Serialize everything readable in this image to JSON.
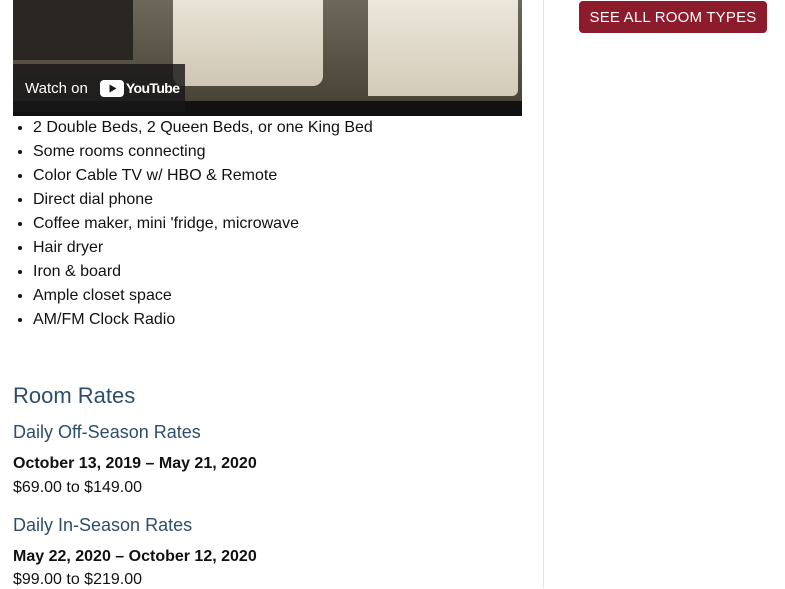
{
  "video": {
    "watch_label": "Watch on",
    "brand": "YouTube"
  },
  "sidebar": {
    "see_all_label": "SEE ALL ROOM TYPES"
  },
  "amenities": [
    "2 Double Beds, 2 Queen Beds, or one King Bed",
    "Some rooms connecting",
    "Color Cable TV w/ HBO & Remote",
    "Direct dial phone",
    "Coffee maker, mini 'fridge, microwave",
    "Hair dryer",
    "Iron & board",
    "Ample closet space",
    "AM/FM Clock Radio"
  ],
  "rates": {
    "heading": "Room Rates",
    "off_season": {
      "title": "Daily Off-Season Rates",
      "dates": "October 13, 2019 – May 21, 2020",
      "price": "$69.00 to $149.00"
    },
    "in_season": {
      "title": "Daily In-Season Rates",
      "dates": "May 22, 2020 – October 12, 2020",
      "price": "$99.00 to $219.00"
    }
  },
  "colors": {
    "accent": "#8c1b2c",
    "heading": "#2d4e6b"
  }
}
